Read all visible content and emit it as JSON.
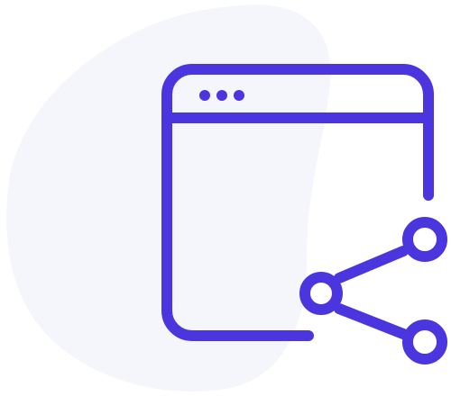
{
  "illustration": {
    "icon": "browser-window-share-icon",
    "colors": {
      "stroke": "#4A35DE",
      "blob": "#F5F5FC",
      "background": "#FFFFFF"
    }
  }
}
